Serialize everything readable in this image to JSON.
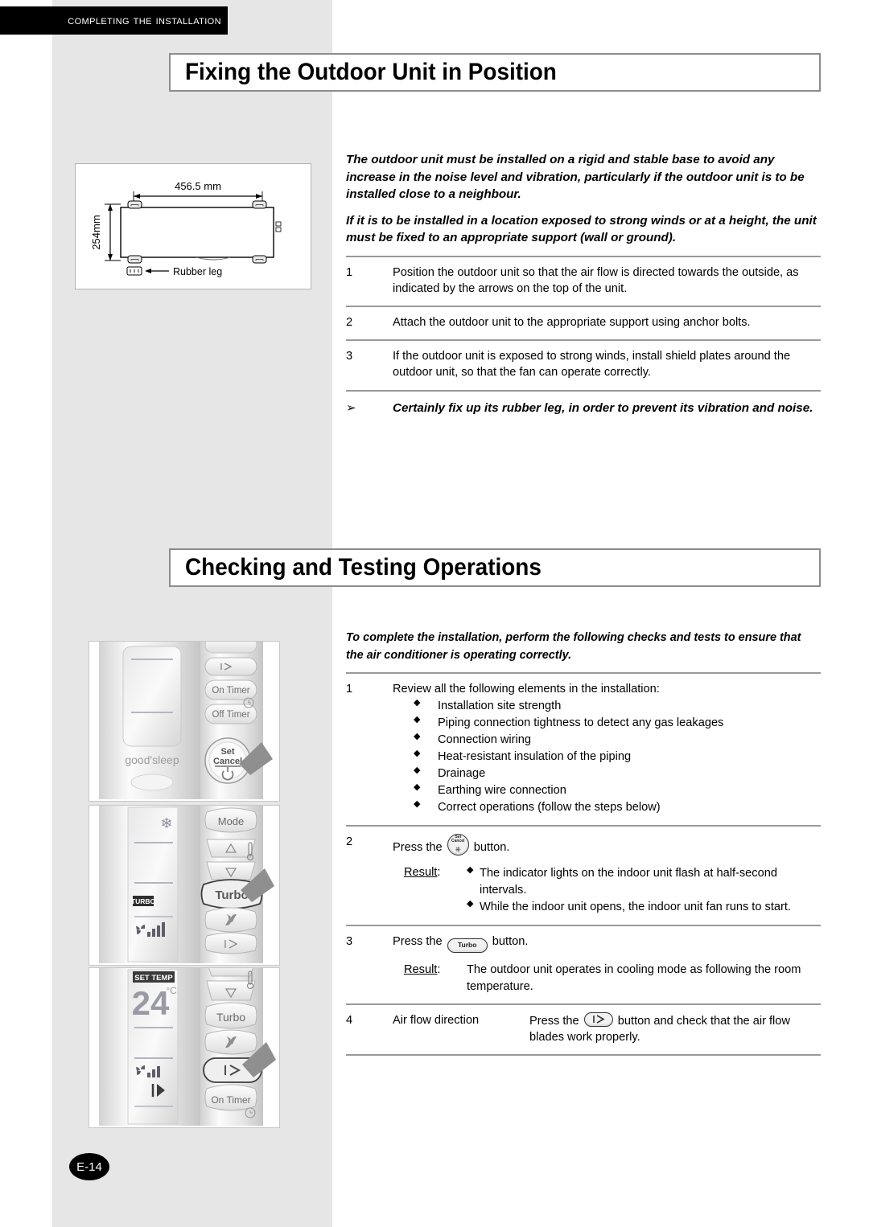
{
  "header": {
    "chapter": "Completing the Installation"
  },
  "page": {
    "number": "E-14"
  },
  "sections": [
    {
      "id": "fixing-outdoor-unit",
      "title": "Fixing the Outdoor Unit in Position",
      "lead": [
        "The outdoor unit must be installed on a rigid and stable base to avoid any increase in the noise level and vibration, particularly if the outdoor unit is to be installed close to a neighbour.",
        "If it is to be installed in a location exposed to strong winds or at a height, the unit must be fixed to an appropriate support (wall or ground)."
      ],
      "steps": [
        {
          "num": "1",
          "text": "Position the outdoor unit so that the air flow is directed towards the outside, as indicated by the arrows on the top of the unit."
        },
        {
          "num": "2",
          "text": "Attach the outdoor unit to the appropriate support using anchor bolts."
        },
        {
          "num": "3",
          "text": "If the outdoor unit is exposed to strong winds, install shield plates around the outdoor unit, so that the fan can operate correctly."
        }
      ],
      "note": {
        "marker": "➢",
        "text": "Certainly fix up its rubber leg, in order to prevent its vibration and noise."
      }
    },
    {
      "id": "checking-testing",
      "title": "Checking and Testing Operations",
      "lead": [
        "To complete the installation, perform the following checks and tests to ensure that the air conditioner is operating correctly."
      ],
      "step1": {
        "num": "1",
        "text": "Review all the following elements in the installation:",
        "items": [
          "Installation site strength",
          "Piping connection tightness to detect any gas leakages",
          "Connection wiring",
          "Heat-resistant insulation of the piping",
          "Drainage",
          "Earthing wire connection",
          "Correct operations (follow the steps below)"
        ]
      },
      "step2": {
        "num": "2",
        "text_before": "Press the",
        "text_after": "button.",
        "button_icon": "set-cancel-button-icon",
        "button_label_top": "Set",
        "button_label_bottom": "Cancel",
        "result_label": "Result",
        "result_items": [
          "The indicator lights on the indoor unit flash at half-second intervals.",
          "While the indoor unit opens, the indoor unit fan runs to start."
        ]
      },
      "step3": {
        "num": "3",
        "text_before": "Press the",
        "text_after": "button.",
        "button_icon": "turbo-button-icon",
        "button_label": "Turbo",
        "result_label": "Result",
        "result_text": "The outdoor unit operates in cooling mode as following the room temperature."
      },
      "step4": {
        "num": "4",
        "label": "Air flow direction",
        "text_before": "Press the",
        "text_after": "button and check that the air flow blades work properly.",
        "button_icon": "air-flow-blade-button-icon"
      }
    }
  ],
  "drawing": {
    "name": "outdoor-unit-base-dimensions",
    "width_label": "456.5 mm",
    "height_label": "254mm",
    "leg_label": "Rubber leg"
  },
  "remotes": [
    {
      "id": "remote-set-cancel",
      "caption_buttons": [
        "On Timer",
        "Off Timer"
      ],
      "display_text": "good'sleep",
      "highlight_button_top": "Set",
      "highlight_button_bottom": "Cancel"
    },
    {
      "id": "remote-turbo",
      "buttons": [
        "Mode",
        "Turbo"
      ],
      "lcd_badge": "TURBO"
    },
    {
      "id": "remote-air-flow",
      "buttons": [
        "Turbo",
        "On Timer"
      ],
      "lcd_title": "SET TEMP",
      "lcd_value": "24",
      "lcd_unit": "°C"
    }
  ],
  "colors": {
    "panel_gray": "#e6e6e6",
    "header_black": "#000000",
    "rule_gray": "#9a9a9a",
    "title_border": "#8c8c8c"
  }
}
